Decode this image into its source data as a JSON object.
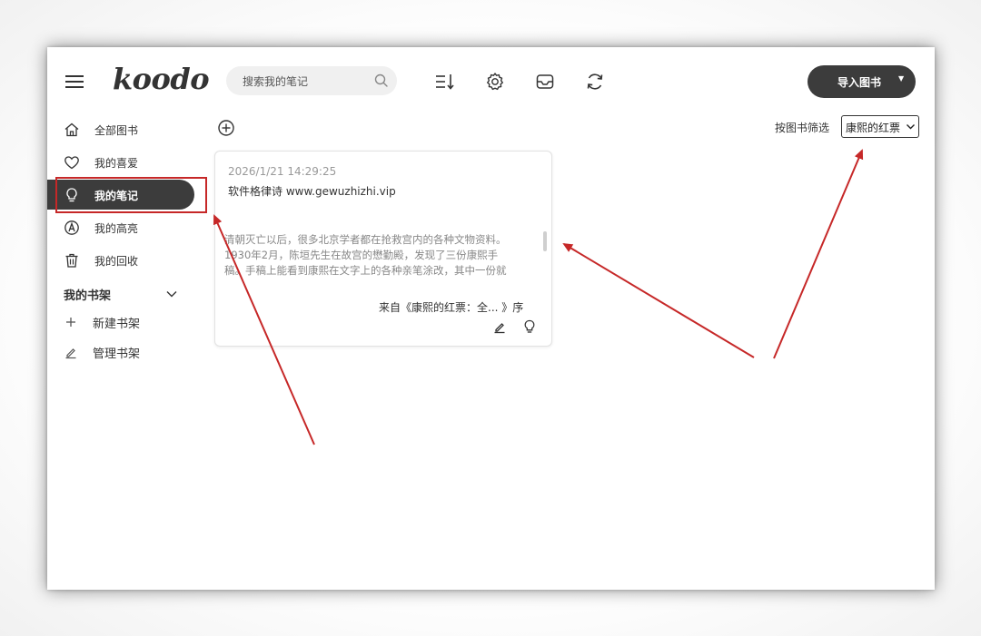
{
  "app": {
    "logo": "koodo",
    "search": {
      "placeholder": "搜索我的笔记"
    },
    "import_button": {
      "label": "导入图书"
    }
  },
  "sidebar": {
    "items": [
      {
        "label": "全部图书",
        "icon": "home-icon"
      },
      {
        "label": "我的喜爱",
        "icon": "heart-icon"
      },
      {
        "label": "我的笔记",
        "icon": "lightbulb-icon",
        "active": true
      },
      {
        "label": "我的高亮",
        "icon": "highlighter-icon"
      },
      {
        "label": "我的回收",
        "icon": "trash-icon"
      }
    ],
    "shelf_title": "我的书架",
    "shelf_actions": [
      {
        "label": "新建书架",
        "icon": "plus-icon"
      },
      {
        "label": "管理书架",
        "icon": "pencil-icon"
      }
    ]
  },
  "content": {
    "filter_label": "按图书筛选",
    "filter_value": "康熙的红票",
    "note": {
      "date": "2026/1/21 14:29:25",
      "title": "软件格律诗 www.gewuzhizhi.vip",
      "text_lines": [
        "清朝灭亡以后，很多北京学者都在抢救宫内的各种文物资料。",
        "1930年2月，陈垣先生在故宫的懋勤殿，发现了三份康熙手",
        "稿。手稿上能看到康熙在文字上的各种亲笔涂改，其中一份就"
      ],
      "source": "来自《康熙的红票：全...  》序"
    }
  },
  "colors": {
    "accent_dark": "#3c3c3c",
    "annotation_red": "#c62828"
  }
}
